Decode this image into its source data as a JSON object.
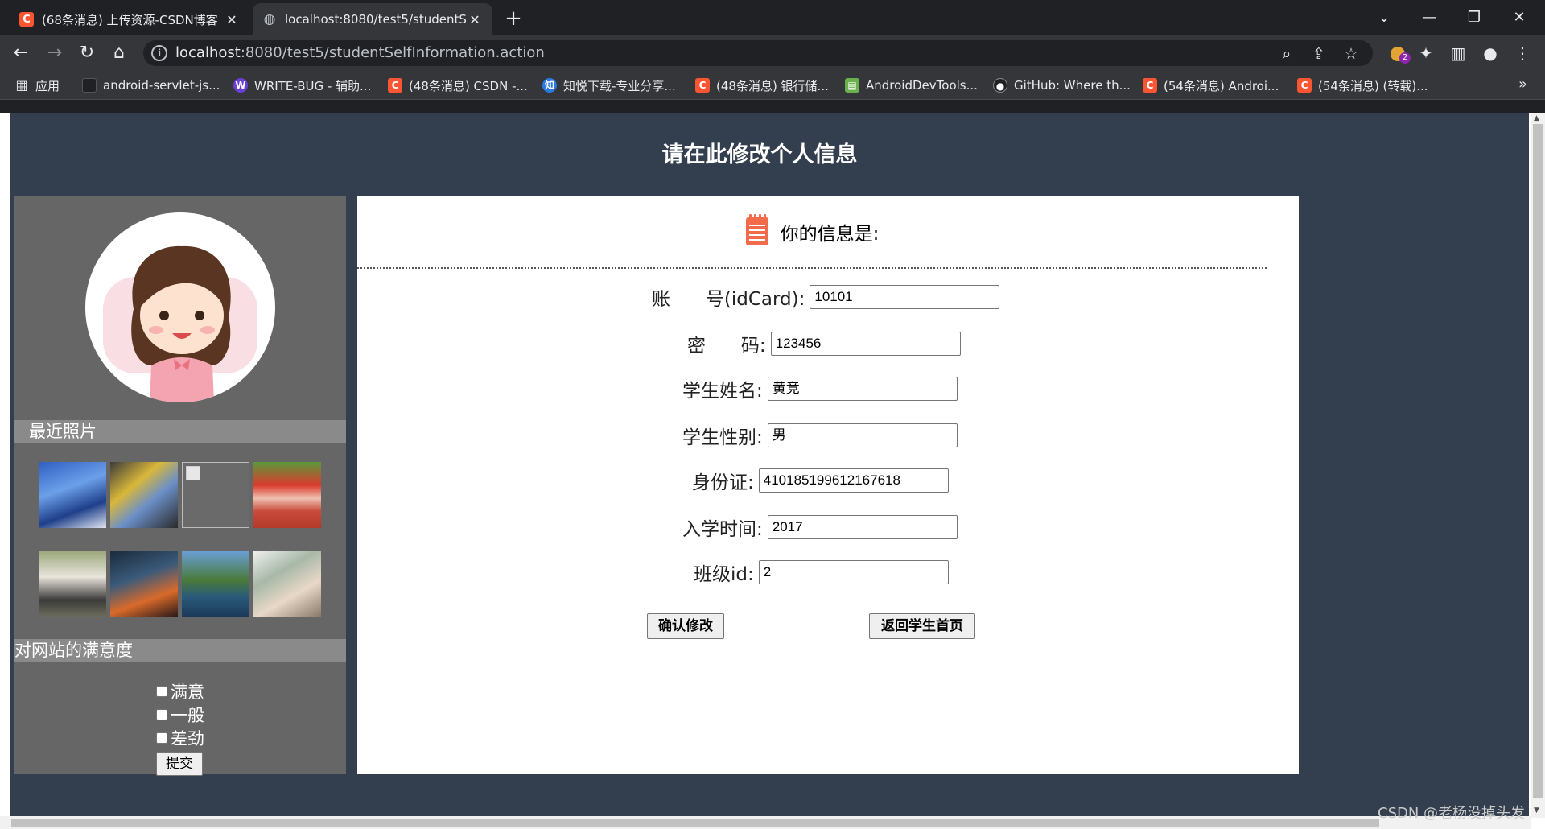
{
  "browser": {
    "tabs": [
      {
        "title": "(68条消息) 上传资源-CSDN博客",
        "favicon": "csdn-icon"
      },
      {
        "title": "localhost:8080/test5/studentS",
        "favicon": "globe-icon"
      }
    ],
    "url_host": "localhost",
    "url_rest": ":8080/test5/studentSelfInformation.action",
    "extension_badge": "2",
    "bookmarks": [
      {
        "label": "应用",
        "icon": "apps-grid-icon"
      },
      {
        "label": "android-servlet-js...",
        "icon": "page-icon"
      },
      {
        "label": "WRITE-BUG - 辅助...",
        "icon": "writebug-icon"
      },
      {
        "label": "(48条消息) CSDN -...",
        "icon": "csdn-icon"
      },
      {
        "label": "知悦下载-专业分享...",
        "icon": "zhiyue-icon"
      },
      {
        "label": "(48条消息) 银行储...",
        "icon": "csdn-icon"
      },
      {
        "label": "AndroidDevTools...",
        "icon": "androiddevtools-icon"
      },
      {
        "label": "GitHub: Where th...",
        "icon": "github-icon"
      },
      {
        "label": "(54条消息) Androi...",
        "icon": "csdn-icon"
      },
      {
        "label": "(54条消息) (转载)...",
        "icon": "csdn-icon"
      }
    ]
  },
  "page": {
    "heading": "请在此修改个人信息",
    "sidebar": {
      "recent_photos_title": "最近照片",
      "satisfaction_title": "对网站的满意度",
      "options": [
        "满意",
        "一般",
        "差劲"
      ],
      "submit_label": "提交"
    },
    "form": {
      "title": "你的信息是:",
      "fields": [
        {
          "label": "账      号(idCard):",
          "value": "10101"
        },
        {
          "label": "密      码:",
          "value": "123456"
        },
        {
          "label": "学生姓名:",
          "value": "黄竞"
        },
        {
          "label": "学生性别:",
          "value": "男"
        },
        {
          "label": "身份证:",
          "value": "410185199612167618"
        },
        {
          "label": "入学时间:",
          "value": "2017"
        },
        {
          "label": "班级id:",
          "value": "2"
        }
      ],
      "confirm_label": "确认修改",
      "back_label": "返回学生首页"
    },
    "watermark": "CSDN @老杨没掉头发"
  },
  "colors": {
    "page_bg": "#333f4f",
    "sidebar_bg": "#666666",
    "section_bar": "#8a8a8a",
    "csdn_red": "#fc5531",
    "notepad_icon": "#f26b4a"
  }
}
